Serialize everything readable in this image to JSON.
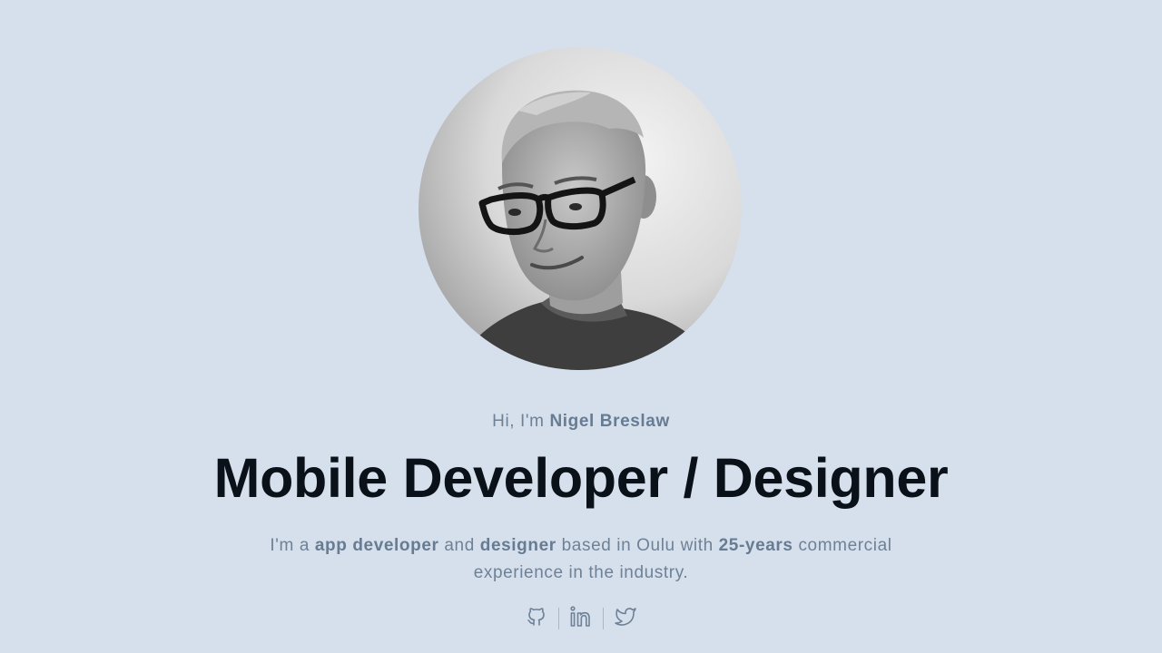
{
  "profile": {
    "photo_alt": "Portrait of Nigel Breslaw",
    "greeting_prefix": "Hi, I'm ",
    "name": "Nigel Breslaw"
  },
  "headline": "Mobile Developer / Designer",
  "intro": {
    "p1": "I'm a ",
    "b1": "app developer",
    "p2": " and ",
    "b2": "designer",
    "p3": " based in Oulu with ",
    "b3": "25-years",
    "p4": " commercial experience in the industry."
  },
  "social": [
    {
      "icon": "github-icon",
      "label": "GitHub"
    },
    {
      "icon": "linkedin-icon",
      "label": "LinkedIn"
    },
    {
      "icon": "twitter-icon",
      "label": "Twitter"
    }
  ],
  "colors": {
    "background": "#d6e0ec",
    "heading": "#0b1118",
    "muted_text": "#6e8196"
  }
}
